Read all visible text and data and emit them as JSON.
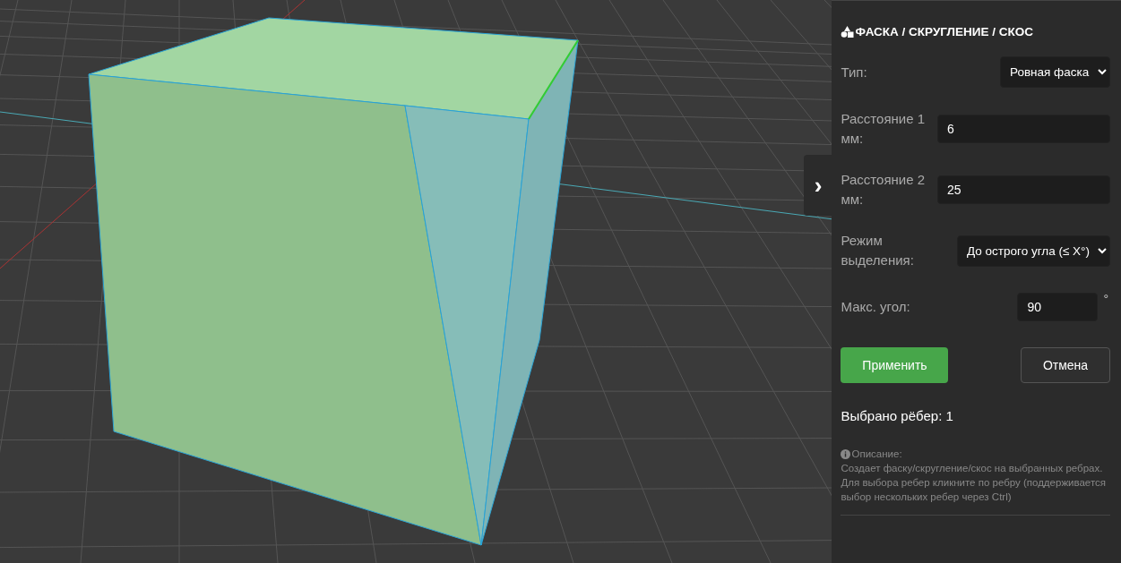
{
  "viewport": {
    "toggle": "›"
  },
  "panel": {
    "title": "ФАСКА / СКРУГЛЕНИЕ / СКОС",
    "fields": [
      {
        "kind": "select",
        "label": "Тип:",
        "value": "Ровная фаска"
      },
      {
        "kind": "input",
        "label": "Расстояние 1 мм:",
        "value": "6"
      },
      {
        "kind": "input",
        "label": "Расстояние 2 мм:",
        "value": "25"
      },
      {
        "kind": "select",
        "label": "Режим выделения:",
        "value": "До острого угла (≤ X°)"
      },
      {
        "kind": "angle",
        "label": "Макс. угол:",
        "value": "90",
        "unit": "°"
      }
    ],
    "buttons": [
      {
        "kind": "primary",
        "label": "Применить"
      },
      {
        "kind": "secondary",
        "label": "Отмена"
      }
    ],
    "selected_count": "Выбрано рёбер: 1",
    "description": {
      "title": "Описание:",
      "paragraphs": [
        "Создает фаску/скругление/скос на выбранных ребрах.",
        "Для выбора ребер кликните по ребру (поддерживается выбор нескольких ребер через Ctrl)"
      ]
    }
  }
}
